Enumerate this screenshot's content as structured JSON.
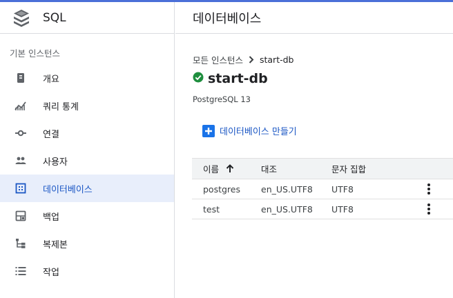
{
  "app": {
    "name": "SQL",
    "accent_color": "#1a73e8",
    "active_bg": "#e8eefb"
  },
  "sidebar": {
    "section_label": "기본 인스턴스",
    "items": [
      {
        "label": "개요",
        "icon": "overview-icon",
        "active": false
      },
      {
        "label": "쿼리 통계",
        "icon": "query-insights-icon",
        "active": false
      },
      {
        "label": "연결",
        "icon": "connection-icon",
        "active": false
      },
      {
        "label": "사용자",
        "icon": "users-icon",
        "active": false
      },
      {
        "label": "데이터베이스",
        "icon": "database-grid-icon",
        "active": true
      },
      {
        "label": "백업",
        "icon": "backup-icon",
        "active": false
      },
      {
        "label": "복제본",
        "icon": "replica-icon",
        "active": false
      },
      {
        "label": "작업",
        "icon": "operations-list-icon",
        "active": false
      }
    ]
  },
  "header": {
    "title": "데이터베이스"
  },
  "breadcrumb": {
    "parent": "모든 인스턴스",
    "current": "start-db"
  },
  "instance": {
    "name": "start-db",
    "status": "running",
    "status_color": "#1e8e3e",
    "version": "PostgreSQL 13"
  },
  "actions": {
    "create_label": "데이터베이스 만들기"
  },
  "table": {
    "headers": [
      "이름",
      "대조",
      "문자 집합"
    ],
    "sort": "ascending",
    "rows": [
      [
        "postgres",
        "en_US.UTF8",
        "UTF8"
      ],
      [
        "test",
        "en_US.UTF8",
        "UTF8"
      ]
    ]
  }
}
